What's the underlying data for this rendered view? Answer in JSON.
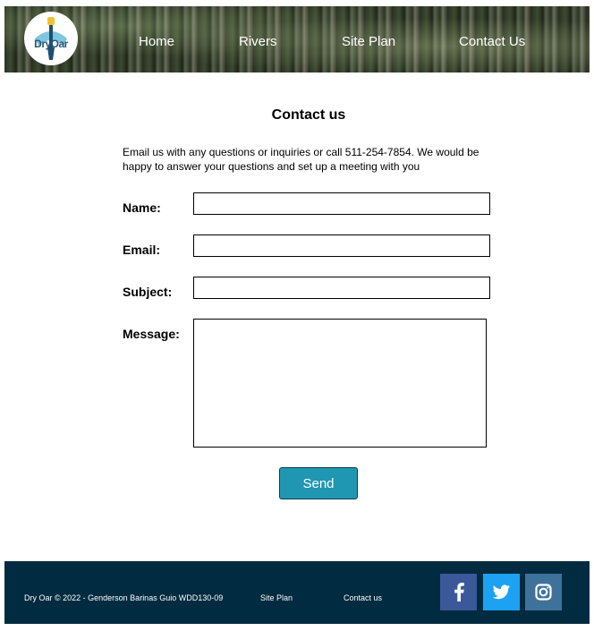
{
  "header": {
    "logo_text": "DryOar",
    "nav": [
      {
        "label": "Home"
      },
      {
        "label": "Rivers"
      },
      {
        "label": "Site Plan"
      },
      {
        "label": "Contact Us"
      }
    ]
  },
  "main": {
    "title": "Contact us",
    "intro": "Email us with any questions or inquiries or call 511-254-7854. We would be happy to answer your questions and set up a meeting with you",
    "form": {
      "name_label": "Name:",
      "name_value": "",
      "email_label": "Email:",
      "email_value": "",
      "subject_label": "Subject:",
      "subject_value": "",
      "message_label": "Message:",
      "message_value": "",
      "send_label": "Send"
    }
  },
  "footer": {
    "copyright": "Dry Oar © 2022 - Genderson Barinas Guio WDD130-09",
    "site_plan": "Site Plan",
    "contact": "Contact us",
    "social": [
      {
        "icon": "facebook-icon",
        "color": "#3b5998"
      },
      {
        "icon": "twitter-icon",
        "color": "#1da1f2"
      },
      {
        "icon": "instagram-icon",
        "color": "#3f729b"
      }
    ]
  },
  "colors": {
    "accent": "#2097b2",
    "footer_bg": "#012b40",
    "logo_blue": "#27577a"
  }
}
